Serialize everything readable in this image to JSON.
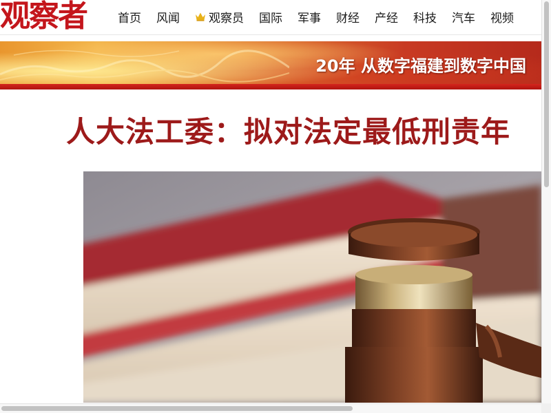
{
  "site": {
    "logo_text": "观察者",
    "brand_color": "#c4161c"
  },
  "nav": {
    "items": [
      {
        "label": "首页"
      },
      {
        "label": "风闻"
      },
      {
        "label": "观察员",
        "icon": "crown-icon",
        "icon_color": "#e8b21a"
      },
      {
        "label": "国际"
      },
      {
        "label": "军事"
      },
      {
        "label": "财经"
      },
      {
        "label": "产经"
      },
      {
        "label": "科技"
      },
      {
        "label": "汽车"
      },
      {
        "label": "视频"
      }
    ]
  },
  "banner": {
    "text": "20年 从数字福建到数字中国",
    "stripe_color": "#c21c16"
  },
  "article": {
    "headline": "人大法工委：拟对法定最低刑责年",
    "headline_color": "#9d1a1a",
    "image_subject": "judge-gavel-with-books"
  }
}
